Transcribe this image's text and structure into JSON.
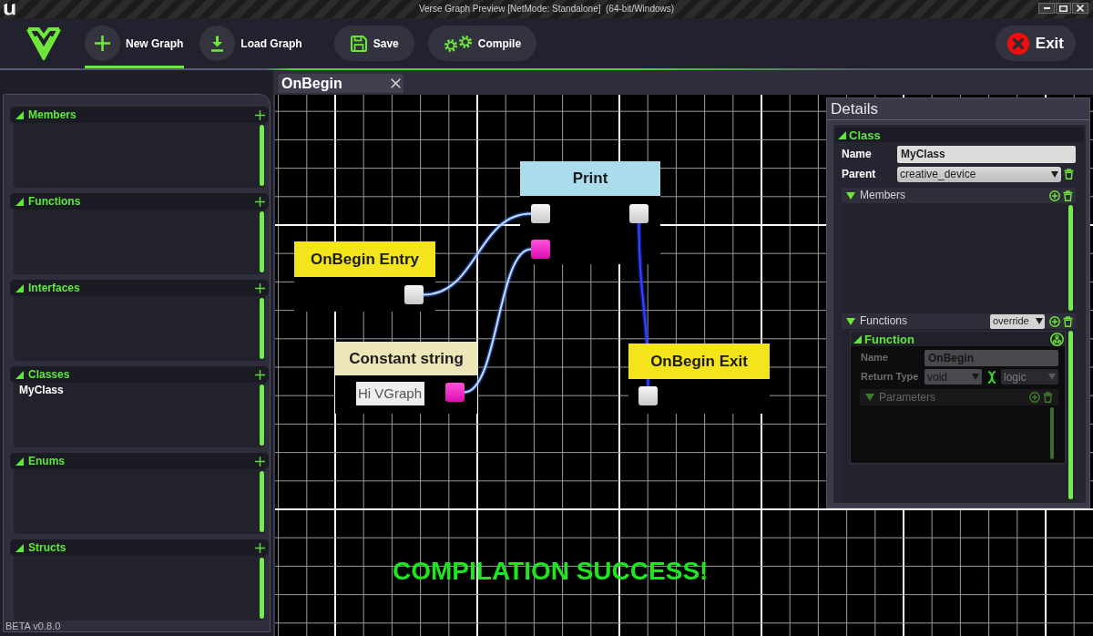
{
  "window": {
    "title": "Verse Graph Preview [NetMode: Standalone]  (64-bit/Windows)"
  },
  "toolbar": {
    "buttons": [
      {
        "label": "New Graph",
        "kind": "new",
        "selected": true
      },
      {
        "label": "Load Graph",
        "kind": "load",
        "selected": false
      },
      {
        "label": "Save",
        "kind": "save",
        "selected": false
      },
      {
        "label": "Compile",
        "kind": "compile",
        "selected": false
      }
    ],
    "exit": {
      "label": "Exit"
    }
  },
  "sidebar": {
    "sections": [
      {
        "title": "Members",
        "expanded": true
      },
      {
        "title": "Functions",
        "expanded": true
      },
      {
        "title": "Interfaces",
        "expanded": true
      },
      {
        "title": "Classes",
        "expanded": true,
        "items": [
          {
            "label": "MyClass"
          }
        ]
      },
      {
        "title": "Enums",
        "expanded": true
      },
      {
        "title": "Structs",
        "expanded": true
      }
    ],
    "version": "BETA v0.8.0"
  },
  "tabs": [
    {
      "label": "OnBegin",
      "selected": true
    }
  ],
  "graph": {
    "nodes": [
      {
        "title": "Print",
        "color": "#aadcec",
        "pins": [
          {
            "kind": "exec",
            "connected": true
          },
          {
            "kind": "string",
            "connected": true
          },
          {
            "kind": "exec",
            "connected": true
          }
        ]
      },
      {
        "title": "OnBegin Entry",
        "color": "#f4e41c",
        "pins": [
          {
            "kind": "exec",
            "connected": true
          }
        ]
      },
      {
        "title": "Constant string",
        "color": "#ece6b8",
        "value": "Hi VGraph",
        "pins": [
          {
            "kind": "string",
            "connected": true
          }
        ]
      },
      {
        "title": "OnBegin Exit",
        "color": "#f4e41c",
        "pins": [
          {
            "kind": "exec",
            "connected": true
          }
        ]
      }
    ],
    "status": "COMPILATION SUCCESS!"
  },
  "details": {
    "title": "Details",
    "class": {
      "title": "Class",
      "expanded": true,
      "fields": [
        {
          "label": "Name",
          "value": "MyClass",
          "kind": "text"
        },
        {
          "label": "Parent",
          "value": "creative_device",
          "kind": "dropdown"
        }
      ],
      "members": {
        "title": "Members",
        "expanded": true
      },
      "functions": {
        "title": "Functions",
        "expanded": true,
        "filter": "override",
        "function": {
          "title": "Function",
          "expanded": true,
          "disabled": true,
          "name_label": "Name",
          "name_value": "OnBegin",
          "return_label": "Return Type",
          "return_types": [
            {
              "value": "void",
              "disabled": false
            },
            {
              "value": "logic",
              "disabled": true
            }
          ],
          "parameters": {
            "title": "Parameters",
            "expanded": true
          }
        }
      }
    }
  }
}
